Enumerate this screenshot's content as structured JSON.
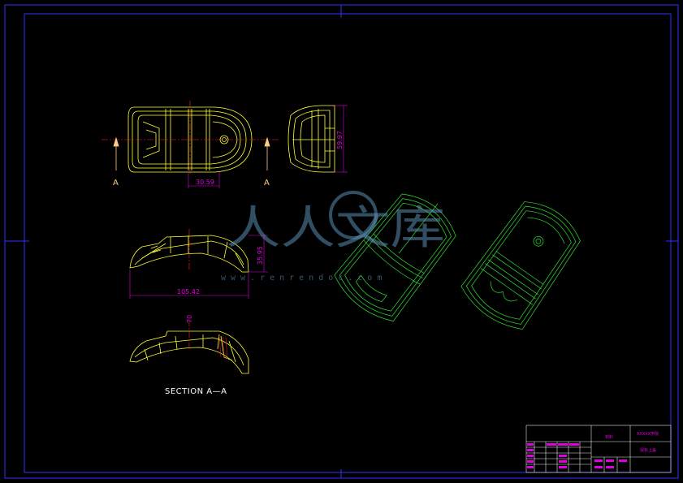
{
  "drawing": {
    "dimensions": {
      "width_top": "30.59",
      "height_side": "59.97",
      "height_front": "35.95",
      "length_front": "105.42",
      "section_dim": "70"
    },
    "section_markers": {
      "left": "A",
      "right": "A"
    },
    "section_label": "SECTION A—A"
  },
  "watermark": {
    "text": "人人文库",
    "url": "www.renrendoc.com"
  },
  "title_block": {
    "drawing_name": "XXXXX学院",
    "part_name": "鼠标上盖",
    "material": "材料"
  },
  "colors": {
    "frame": "#3030ff",
    "part_lines": "#ffff30",
    "iso_lines": "#30e030",
    "dimension": "#e000e0",
    "centerline": "#ff2020"
  }
}
